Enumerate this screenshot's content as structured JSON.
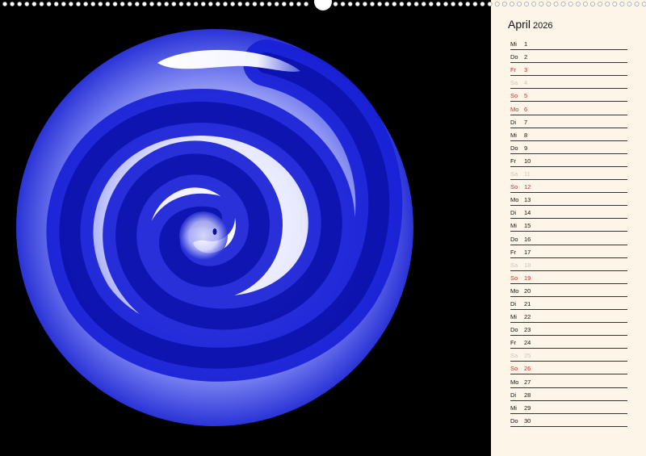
{
  "calendar": {
    "month": "April",
    "year": "2026"
  },
  "colors": {
    "background": "#000000",
    "panel": "#fdf6e8",
    "spiral_blue": "#1a22d8",
    "spiral_highlight": "#ffffff",
    "sunday_red": "#d42a2a",
    "saturday_grey": "#c9c4bc"
  },
  "days": [
    {
      "wd": "Mi",
      "d": "1",
      "type": "normal"
    },
    {
      "wd": "Do",
      "d": "2",
      "type": "normal"
    },
    {
      "wd": "Fr",
      "d": "3",
      "type": "sun"
    },
    {
      "wd": "Sa",
      "d": "4",
      "type": "sat"
    },
    {
      "wd": "So",
      "d": "5",
      "type": "sun"
    },
    {
      "wd": "Mo",
      "d": "6",
      "type": "sun"
    },
    {
      "wd": "Di",
      "d": "7",
      "type": "normal"
    },
    {
      "wd": "Mi",
      "d": "8",
      "type": "normal"
    },
    {
      "wd": "Do",
      "d": "9",
      "type": "normal"
    },
    {
      "wd": "Fr",
      "d": "10",
      "type": "normal"
    },
    {
      "wd": "Sa",
      "d": "11",
      "type": "sat"
    },
    {
      "wd": "So",
      "d": "12",
      "type": "sun"
    },
    {
      "wd": "Mo",
      "d": "13",
      "type": "normal"
    },
    {
      "wd": "Di",
      "d": "14",
      "type": "normal"
    },
    {
      "wd": "Mi",
      "d": "15",
      "type": "normal"
    },
    {
      "wd": "Do",
      "d": "16",
      "type": "normal"
    },
    {
      "wd": "Fr",
      "d": "17",
      "type": "normal"
    },
    {
      "wd": "Sa",
      "d": "18",
      "type": "sat"
    },
    {
      "wd": "So",
      "d": "19",
      "type": "sun"
    },
    {
      "wd": "Mo",
      "d": "20",
      "type": "normal"
    },
    {
      "wd": "Di",
      "d": "21",
      "type": "normal"
    },
    {
      "wd": "Mi",
      "d": "22",
      "type": "normal"
    },
    {
      "wd": "Do",
      "d": "23",
      "type": "normal"
    },
    {
      "wd": "Fr",
      "d": "24",
      "type": "normal"
    },
    {
      "wd": "Sa",
      "d": "25",
      "type": "sat"
    },
    {
      "wd": "So",
      "d": "26",
      "type": "sun"
    },
    {
      "wd": "Mo",
      "d": "27",
      "type": "normal"
    },
    {
      "wd": "Di",
      "d": "28",
      "type": "normal"
    },
    {
      "wd": "Mi",
      "d": "29",
      "type": "normal"
    },
    {
      "wd": "Do",
      "d": "30",
      "type": "normal"
    }
  ]
}
